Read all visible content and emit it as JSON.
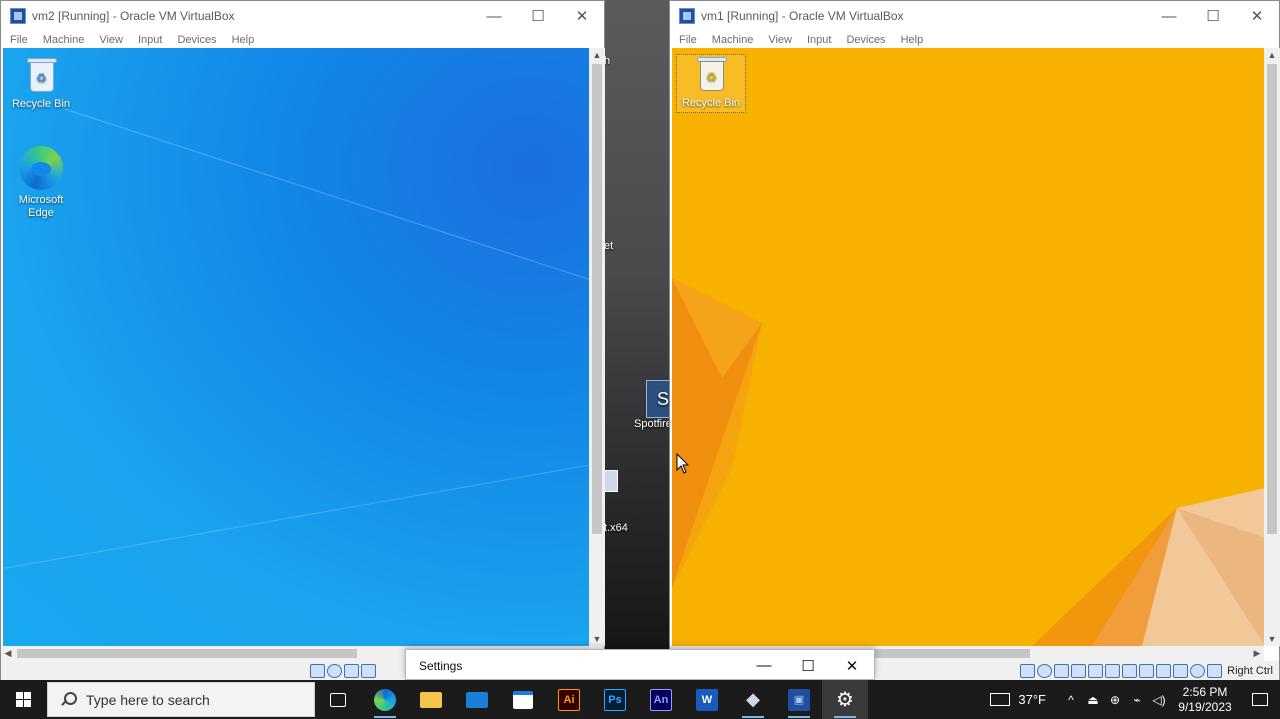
{
  "host_desktop": {
    "partial_labels": [
      "h",
      "et",
      "t.x64"
    ],
    "spotfire_label": "Spotfire"
  },
  "vm2": {
    "title": "vm2 [Running] - Oracle VM VirtualBox",
    "menu": [
      "File",
      "Machine",
      "View",
      "Input",
      "Devices",
      "Help"
    ],
    "desktop_icons": [
      {
        "label": "Recycle Bin",
        "icon": "recycle-bin-icon"
      },
      {
        "label": "Microsoft Edge",
        "icon": "edge-icon"
      }
    ],
    "wallpaper_color": "#1a8fe8"
  },
  "vm1": {
    "title": "vm1 [Running] - Oracle VM VirtualBox",
    "menu": [
      "File",
      "Machine",
      "View",
      "Input",
      "Devices",
      "Help"
    ],
    "desktop_icons": [
      {
        "label": "Recycle Bin",
        "icon": "recycle-bin-icon"
      }
    ],
    "host_key": "Right Ctrl",
    "wallpaper_color": "#f7b100"
  },
  "settings_window": {
    "title": "Settings"
  },
  "taskbar": {
    "search_placeholder": "Type here to search",
    "apps": [
      {
        "name": "task-view",
        "glyph": "⊞"
      },
      {
        "name": "edge",
        "glyph": ""
      },
      {
        "name": "file-explorer",
        "glyph": ""
      },
      {
        "name": "mail",
        "glyph": "✉"
      },
      {
        "name": "microsoft-store",
        "glyph": ""
      },
      {
        "name": "illustrator",
        "glyph": "Ai"
      },
      {
        "name": "photoshop",
        "glyph": "Ps"
      },
      {
        "name": "animate",
        "glyph": "An"
      },
      {
        "name": "word",
        "glyph": "W"
      },
      {
        "name": "virtualbox-manager",
        "glyph": "◆"
      },
      {
        "name": "virtualbox-vm",
        "glyph": "▣"
      },
      {
        "name": "settings",
        "glyph": "⚙"
      }
    ],
    "tray": {
      "temperature": "37°F",
      "time": "2:56 PM",
      "date": "9/19/2023"
    }
  },
  "colors": {
    "accent": "#76b9ed",
    "taskbar_bg": "#1b1b1b"
  }
}
